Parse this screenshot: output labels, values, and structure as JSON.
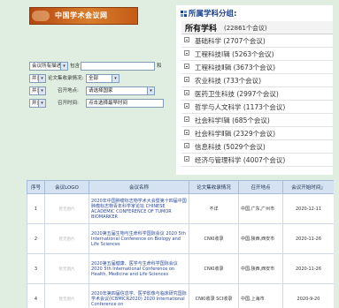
{
  "banner": {
    "title": "中国学术会议网"
  },
  "search": {
    "row1": {
      "field_select": "会议所有描述",
      "op_label": "包含",
      "value": "",
      "tail": "和"
    },
    "row2": {
      "bool_select": "并且",
      "label": "论文集收录情况:",
      "value": "全部"
    },
    "row3": {
      "bool_select": "并且",
      "label": "召开地点:",
      "value": "请选择国家"
    },
    "row4": {
      "bool_select": "并且",
      "label": "召开时间:",
      "value": "点击选择最早时间"
    }
  },
  "subjects": {
    "title": "所属学科分组:",
    "all": {
      "label": "所有学科",
      "count": "(22861个会议)"
    },
    "items": [
      {
        "label": "基础科学 (2707个会议)"
      },
      {
        "label": "工程科技Ⅰ辑 (5263个会议)"
      },
      {
        "label": "工程科技Ⅱ辑 (3673个会议)"
      },
      {
        "label": "农业科技 (733个会议)"
      },
      {
        "label": "医药卫生科技 (2997个会议)"
      },
      {
        "label": "哲学与人文科学 (1173个会议)"
      },
      {
        "label": "社会科学Ⅰ辑 (685个会议)"
      },
      {
        "label": "社会科学Ⅱ辑 (2329个会议)"
      },
      {
        "label": "信息科技 (5029个会议)"
      },
      {
        "label": "经济与管理科学 (4007个会议)"
      }
    ]
  },
  "table": {
    "headers": [
      "序号",
      "会议LOGO",
      "会议名称",
      "论文集收录情况",
      "召开地点",
      "会议开始时间」"
    ],
    "rows": [
      {
        "no": "1",
        "logo": "暂无图片",
        "name": "2020年中国肿瘤标志物学术大会暨第十四届中国肿瘤标志物青年科学家论坛 CHINESE ACADEMIC CONFERENCE OF TUMOR BIOMARKER",
        "index": "不详",
        "place": "中国,广东,广州市",
        "date": "2020-12-11"
      },
      {
        "no": "2",
        "logo": "暂无图片",
        "name": "2020第五届生物与生命科学国际会议 2020 5th International Conference on Biology and Life Sciences",
        "index": "CNKI收录",
        "place": "中国,陕西,西安市",
        "date": "2020-11-26"
      },
      {
        "no": "3",
        "logo": "暂无图片",
        "name": "2020第五届健康、医学与生命科学国际会议 2020 5th International Conference on Health, Medicine and Life Sciences",
        "index": "CNKI收录",
        "place": "中国,陕西,西安市",
        "date": "2020-11-26"
      },
      {
        "no": "4",
        "logo": "暂无图片",
        "name": "2020年第四届信息学、医学影像与临床研究国际学术会议(ICBMICR2020) 2020 International Conference on",
        "index": "CNKI收录 SCI收录",
        "place": "中国,上海市",
        "date": "2020-9-20"
      }
    ]
  },
  "colors": {
    "background": "#dfeee0",
    "banner": "#c45b16",
    "subject_title": "#1a3f8b",
    "table_header": "#d5e2f1"
  }
}
